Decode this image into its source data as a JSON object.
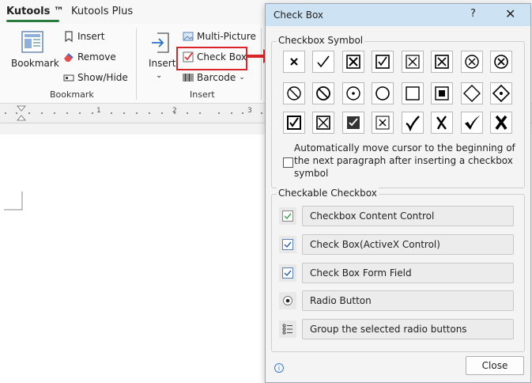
{
  "ribbon": {
    "tabs": [
      {
        "label": "Kutools ™",
        "active": true
      },
      {
        "label": "Kutools Plus",
        "active": false
      }
    ],
    "bookmark_group": {
      "label": "Bookmark",
      "big_button": "Bookmark",
      "items": [
        "Insert",
        "Remove",
        "Show/Hide"
      ]
    },
    "insert_group": {
      "label": "Insert",
      "big_button": "Insert",
      "items": [
        "Multi-Picture",
        "Check Box",
        "Barcode"
      ]
    }
  },
  "ruler": {
    "ticks": [
      "1",
      "2",
      "3"
    ]
  },
  "dialog": {
    "title": "Check Box",
    "help_label": "?",
    "close_label": "✕",
    "symbol_section": {
      "label": "Checkbox Symbol",
      "symbols": [
        "x-mark",
        "check-mark",
        "boxed-x",
        "boxed-check",
        "boxed-x-light",
        "boxed-x-2",
        "circled-x",
        "circled-x-2",
        "prohibited",
        "prohibited-2",
        "circled-dot",
        "circle",
        "empty-square",
        "filled-square",
        "diamond",
        "dotted-diamond",
        "heavy-boxed-check",
        "boxed-cross",
        "filled-boxed-check",
        "ballot-box-x",
        "heavy-check",
        "heavy-x",
        "bold-check",
        "bold-x"
      ]
    },
    "auto_move_option": {
      "label": "Automatically move cursor to the beginning of the next paragraph after inserting a checkbox symbol",
      "checked": false
    },
    "checkable_section": {
      "label": "Checkable Checkbox",
      "items": [
        {
          "label": "Checkbox Content Control",
          "icon": "green-check-icon"
        },
        {
          "label": "Check Box(ActiveX Control)",
          "icon": "blue-check-icon"
        },
        {
          "label": "Check Box Form Field",
          "icon": "blue-check-icon"
        },
        {
          "label": "Radio Button",
          "icon": "radio-icon"
        },
        {
          "label": "Group the selected radio buttons",
          "icon": "list-icon"
        }
      ]
    },
    "close_button": "Close",
    "info_icon": "i"
  },
  "colors": {
    "accent_green": "#2b7a3e",
    "highlight_red": "#d9262b",
    "title_bar": "#cde3f4"
  }
}
